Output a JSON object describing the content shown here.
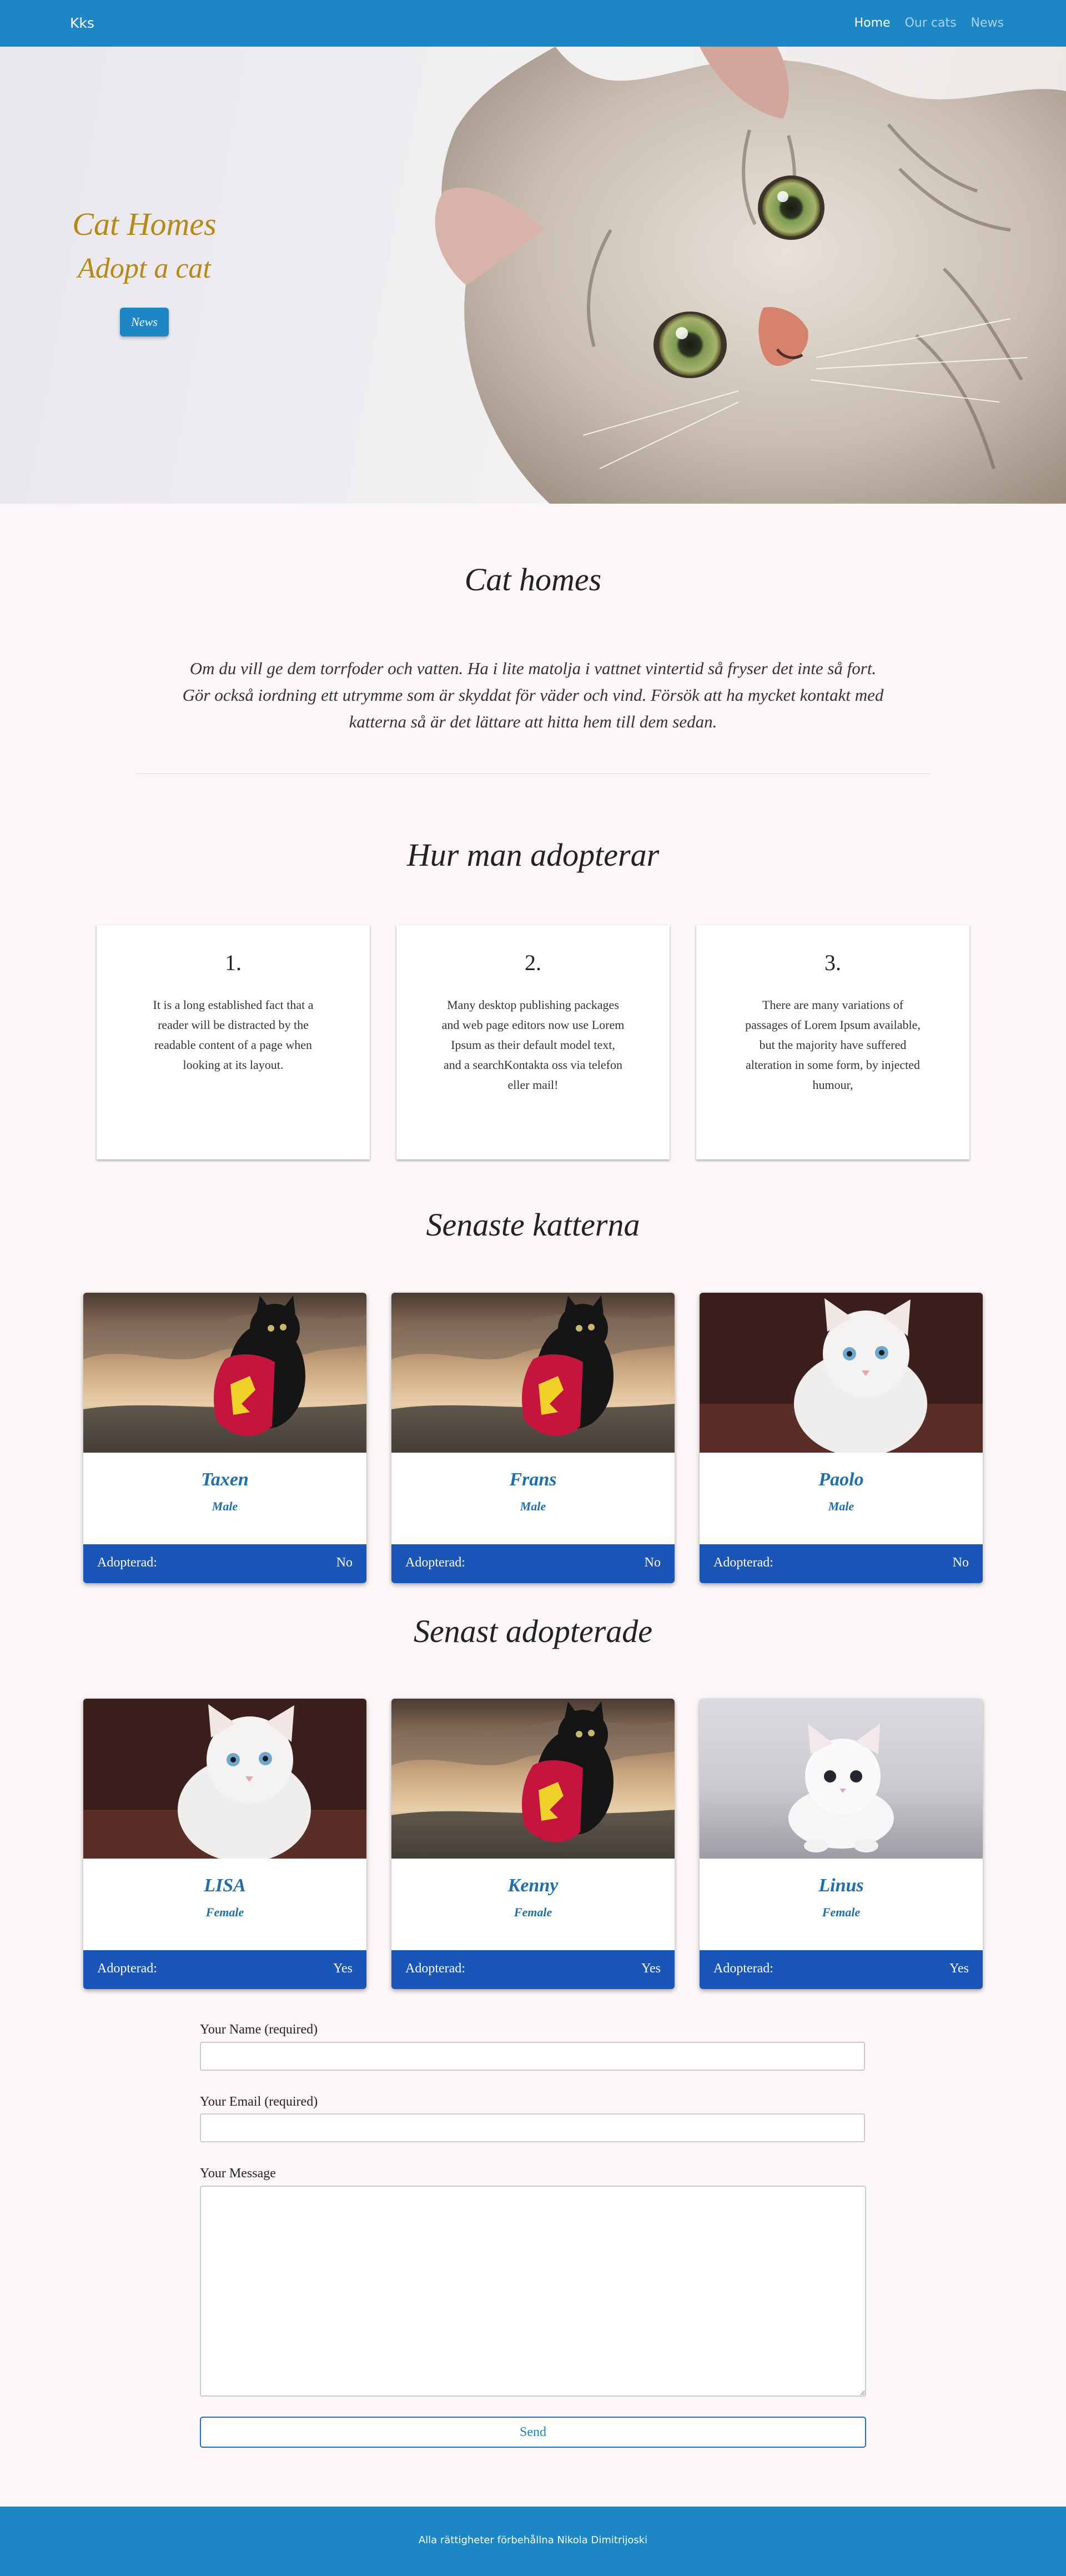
{
  "navbar": {
    "brand": "Kks",
    "links": [
      {
        "label": "Home",
        "active": true
      },
      {
        "label": "Our cats",
        "active": false
      },
      {
        "label": "News",
        "active": false
      }
    ]
  },
  "hero": {
    "title": "Cat Homes",
    "subtitle": "Adopt a cat",
    "button": "News"
  },
  "about": {
    "title": "Cat homes",
    "text": "Om du vill ge dem torrfoder och vatten. Ha i lite matolja i vattnet vintertid så fryser det inte så fort. Gör också iordning ett utrymme som är skyddat för väder och vind. Försök att ha mycket kontakt med katterna så är det lättare att hitta hem till dem sedan."
  },
  "how_to": {
    "title": "Hur man adopterar",
    "steps": [
      {
        "number": "1.",
        "text": "It is a long established fact that a reader will be distracted by the readable content of a page when looking at its layout."
      },
      {
        "number": "2.",
        "text": "Many desktop publishing packages and web page editors now use Lorem Ipsum as their default model text, and a searchKontakta oss via telefon eller mail!"
      },
      {
        "number": "3.",
        "text": "There are many variations of passages of Lorem Ipsum available, but the majority have suffered alteration in some form, by injected humour,"
      }
    ]
  },
  "latest_cats": {
    "title": "Senaste katterna",
    "cats": [
      {
        "name": "Taxen",
        "gender": "Male",
        "adopted_label": "Adopterad:",
        "adopted": "No",
        "photo": "black-cat-cape-photo"
      },
      {
        "name": "Frans",
        "gender": "Male",
        "adopted_label": "Adopterad:",
        "adopted": "No",
        "photo": "black-cat-cape-photo"
      },
      {
        "name": "Paolo",
        "gender": "Male",
        "adopted_label": "Adopterad:",
        "adopted": "No",
        "photo": "white-kitten-photo"
      }
    ]
  },
  "recently_adopted": {
    "title": "Senast adopterade",
    "cats": [
      {
        "name": "LISA",
        "gender": "Female",
        "adopted_label": "Adopterad:",
        "adopted": "Yes",
        "photo": "white-kitten-photo"
      },
      {
        "name": "Kenny",
        "gender": "Female",
        "adopted_label": "Adopterad:",
        "adopted": "Yes",
        "photo": "black-cat-cape-photo"
      },
      {
        "name": "Linus",
        "gender": "Female",
        "adopted_label": "Adopterad:",
        "adopted": "Yes",
        "photo": "white-kitten-floor-photo"
      }
    ]
  },
  "contact_form": {
    "name_label": "Your Name (required)",
    "name_value": "",
    "email_label": "Your Email (required)",
    "email_value": "",
    "message_label": "Your Message",
    "message_value": "",
    "send_label": "Send"
  },
  "footer": {
    "text": "Alla rättigheter förbehållna Nikola Dimitrijoski"
  },
  "colors": {
    "primary": "#1d87c6",
    "card_footer": "#1a55b8",
    "hero_text": "#b68a12",
    "cat_name": "#1d6fae",
    "page_bg": "#fbf7f6"
  }
}
